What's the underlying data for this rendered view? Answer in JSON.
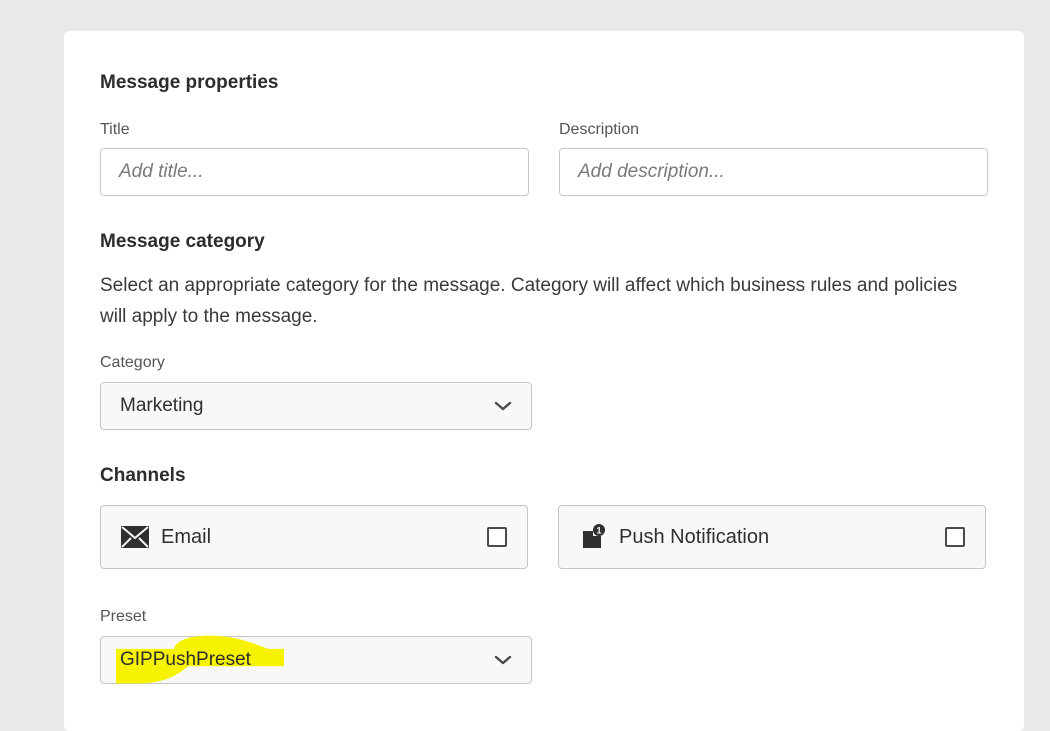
{
  "colors": {
    "page_bg": "#e9e9e9",
    "card_bg": "#ffffff",
    "highlight": "#f6f200"
  },
  "message_properties": {
    "heading": "Message properties",
    "title_label": "Title",
    "title_placeholder": "Add title...",
    "description_label": "Description",
    "description_placeholder": "Add description..."
  },
  "message_category": {
    "heading": "Message category",
    "description": "Select an appropriate category for the message. Category will affect which business rules and policies will apply to the message.",
    "category_label": "Category",
    "category_value": "Marketing"
  },
  "channels": {
    "heading": "Channels",
    "items": [
      {
        "label": "Email",
        "icon": "envelope-icon",
        "checked": false
      },
      {
        "label": "Push Notification",
        "icon": "push-notification-icon",
        "badge": "1",
        "checked": false
      }
    ]
  },
  "preset": {
    "label": "Preset",
    "value": "GIPPushPreset"
  }
}
